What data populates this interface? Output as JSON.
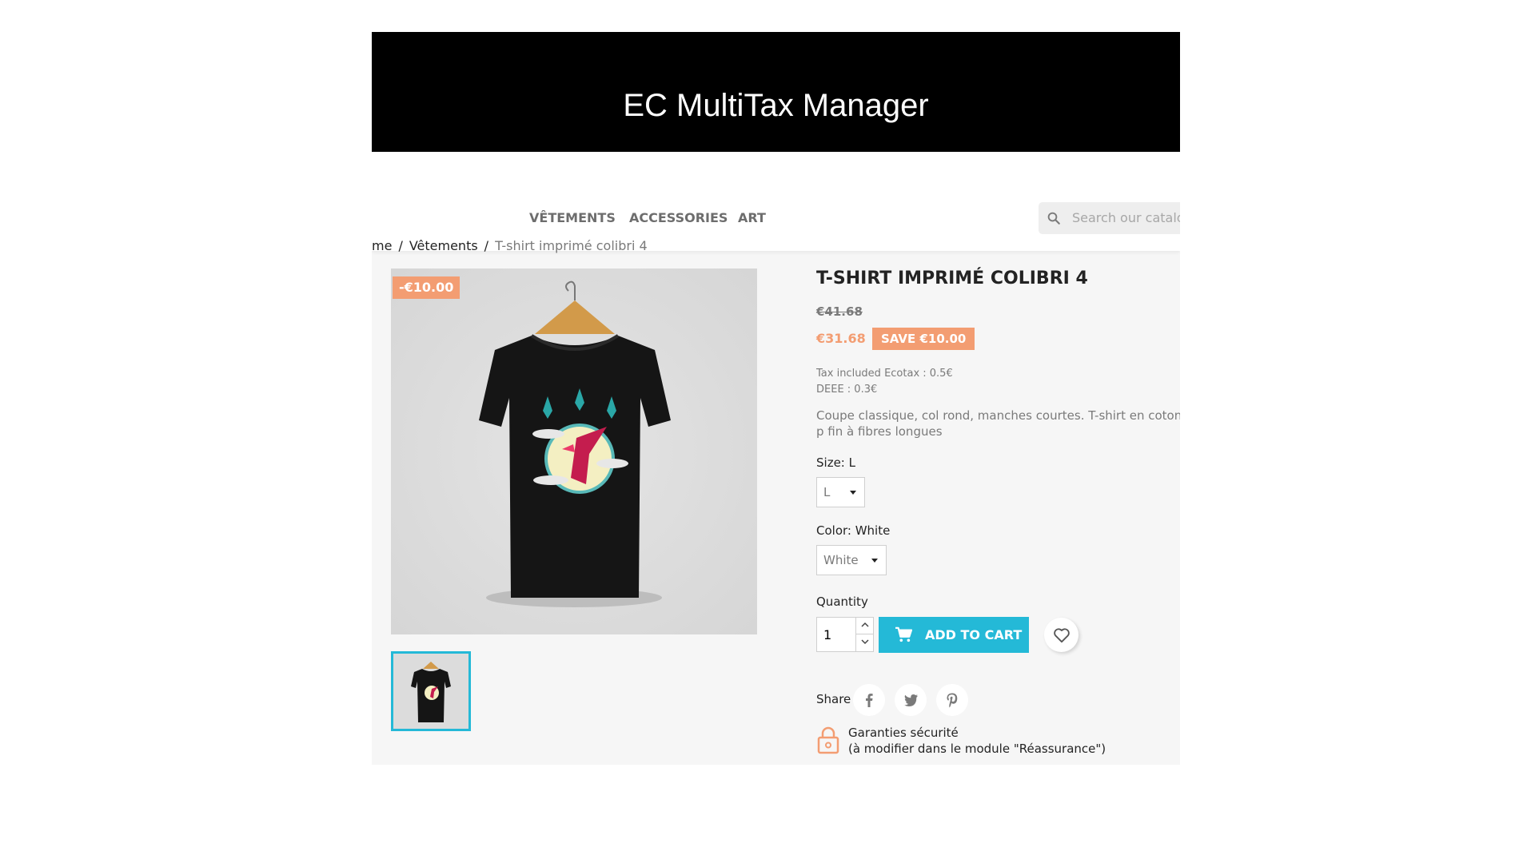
{
  "banner": {
    "title": "EC MultiTax Manager"
  },
  "nav": {
    "items": [
      "VÊTEMENTS",
      "ACCESSORIES",
      "ART"
    ],
    "search_placeholder": "Search our catalog"
  },
  "breadcrumb": {
    "home": "me",
    "category": "Vêtements",
    "current": "T-shirt imprimé colibri 4",
    "separator": "/"
  },
  "product": {
    "discount_flag": "-€10.00",
    "title": "T-SHIRT IMPRIMÉ COLIBRI 4",
    "old_price": "€41.68",
    "price": "€31.68",
    "save_badge": "SAVE €10.00",
    "tax_line": "Tax included Ecotax : 0.5€",
    "deee_line": "DEEE : 0.3€",
    "description": "Coupe classique, col rond, manches courtes. T-shirt en coton p fin à fibres longues",
    "size_label": "Size: L",
    "size_value": "L",
    "color_label": "Color: White",
    "color_value": "White",
    "quantity_label": "Quantity",
    "quantity_value": "1",
    "add_to_cart": "ADD TO CART",
    "share_label": "Share",
    "reassurance_line1": "Garanties sécurité",
    "reassurance_line2": "(à modifier dans le module \"Réassurance\")"
  },
  "colors": {
    "accent": "#24b9d7",
    "discount": "#f39d72",
    "banner": "#000000"
  }
}
